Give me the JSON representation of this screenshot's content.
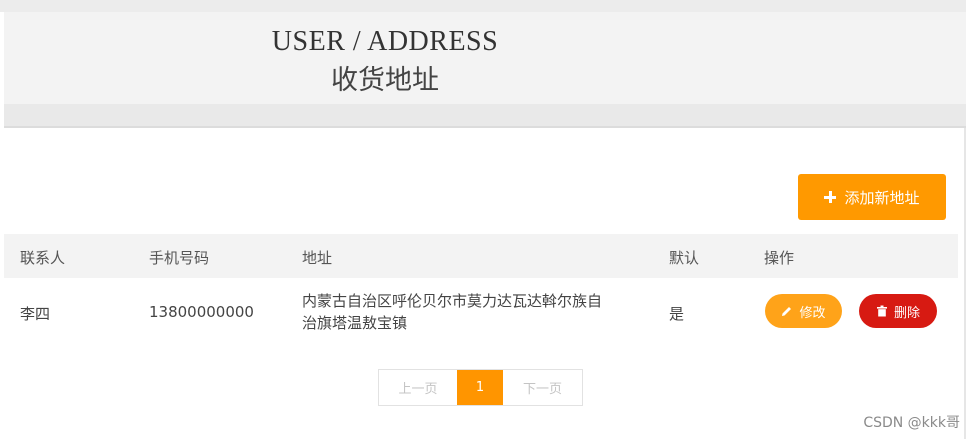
{
  "header": {
    "title_en": "USER / ADDRESS",
    "title_cn": "收货地址"
  },
  "toolbar": {
    "add_label": "添加新地址"
  },
  "table": {
    "columns": [
      "联系人",
      "手机号码",
      "地址",
      "默认",
      "操作"
    ],
    "rows": [
      {
        "contact": "李四",
        "phone": "13800000000",
        "address_line1": "内蒙古自治区呼伦贝尔市莫力达瓦达斡尔族自",
        "address_line2": "治旗塔温敖宝镇",
        "default": "是",
        "edit_label": "修改",
        "delete_label": "删除"
      }
    ]
  },
  "pagination": {
    "prev": "上一页",
    "current": "1",
    "next": "下一页"
  },
  "watermark": "CSDN @kkk哥",
  "colors": {
    "accent": "#ff9900",
    "edit": "#ffa319",
    "delete": "#d71a12"
  }
}
